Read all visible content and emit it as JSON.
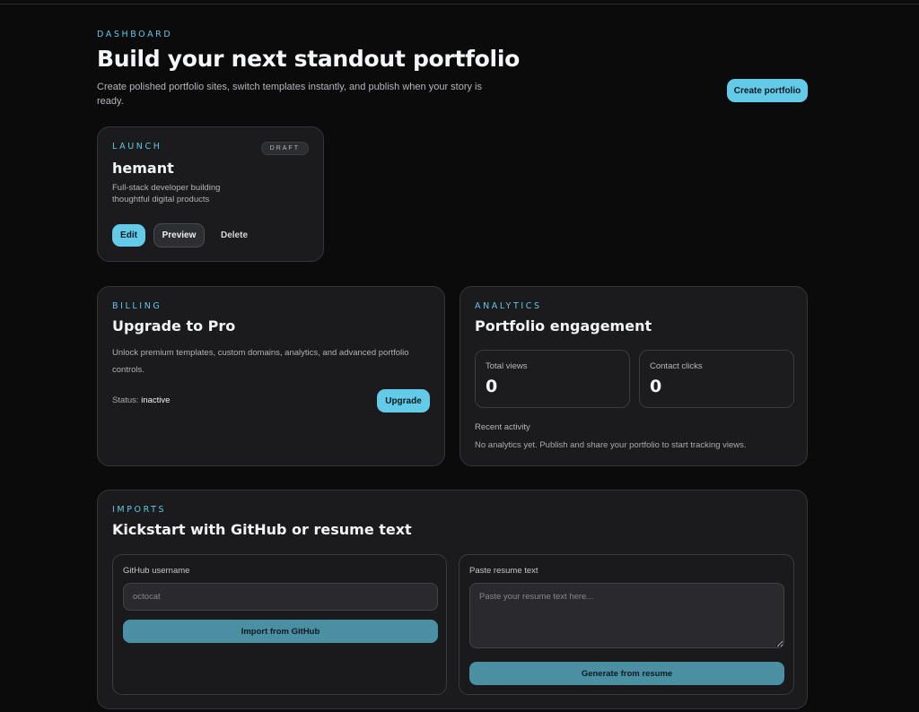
{
  "header": {
    "eyebrow": "DASHBOARD",
    "title": "Build your next standout portfolio",
    "subtitle": "Create polished portfolio sites, switch templates instantly, and publish when your story is ready.",
    "create_label": "Create portfolio"
  },
  "launch": {
    "eyebrow": "LAUNCH",
    "badge": "DRAFT",
    "name": "hemant",
    "description": "Full-stack developer building thoughtful digital products",
    "edit_label": "Edit",
    "preview_label": "Preview",
    "delete_label": "Delete"
  },
  "billing": {
    "eyebrow": "BILLING",
    "title": "Upgrade to Pro",
    "description": "Unlock premium templates, custom domains, analytics, and advanced portfolio controls.",
    "status_label": "Status:",
    "status_value": "inactive",
    "upgrade_label": "Upgrade"
  },
  "analytics": {
    "eyebrow": "ANALYTICS",
    "title": "Portfolio engagement",
    "total_views_label": "Total views",
    "total_views_value": "0",
    "contact_clicks_label": "Contact clicks",
    "contact_clicks_value": "0",
    "recent_label": "Recent activity",
    "recent_text": "No analytics yet. Publish and share your portfolio to start tracking views."
  },
  "imports": {
    "eyebrow": "IMPORTS",
    "title": "Kickstart with GitHub or resume text",
    "github_label": "GitHub username",
    "github_placeholder": "octocat",
    "github_button": "Import from GitHub",
    "resume_label": "Paste resume text",
    "resume_placeholder": "Paste your resume text here...",
    "resume_button": "Generate from resume"
  },
  "colors": {
    "accent": "#63cbe8",
    "background": "#0b0b0c",
    "card": "#1b1b1e",
    "muted_button": "#4b8fa3"
  }
}
